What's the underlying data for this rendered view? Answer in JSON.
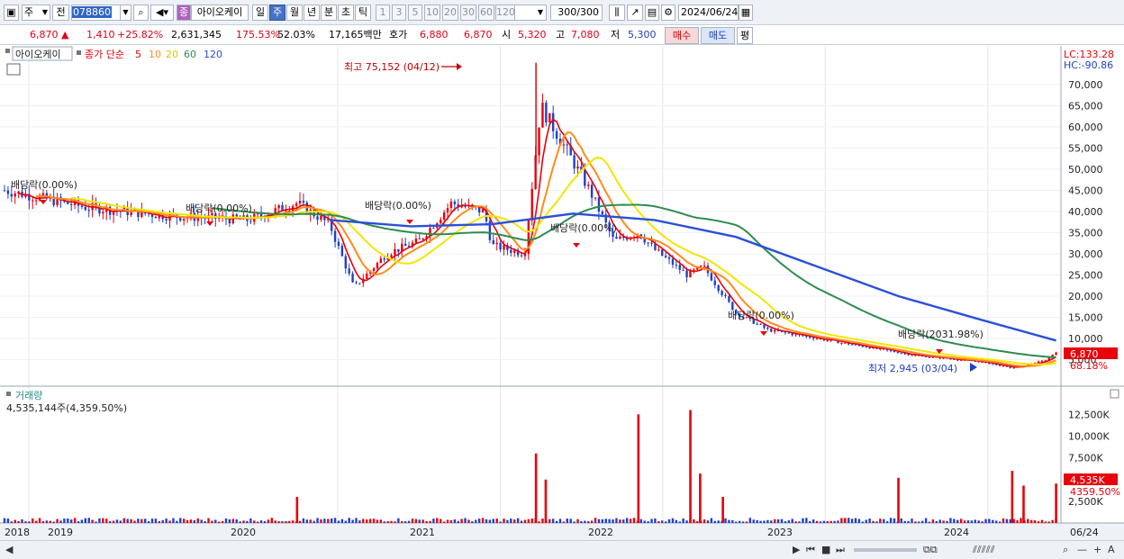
{
  "toolbar": {
    "period_select": "주",
    "prev_label": "전",
    "code_value": "078860",
    "name_badge": "종",
    "stock_name": "아이오케이",
    "tabs": [
      "일",
      "주",
      "월",
      "년",
      "분",
      "초",
      "틱"
    ],
    "selected_tab": "주",
    "interval_buttons": [
      "1",
      "3",
      "5",
      "10",
      "20",
      "30",
      "60",
      "120"
    ],
    "count_value": "300",
    "count_total": "/300",
    "date_value": "2024/06/24"
  },
  "quote": {
    "price": "6,870",
    "change": "1,410",
    "change_pct": "+25.82%",
    "volume": "2,631,345",
    "vol_ratio": "175.53%",
    "turnover": "52.03%",
    "amount": "17,165백만",
    "ask_label": "호가",
    "ask_value": "6,880",
    "bid_value": "6,870",
    "open_label": "시",
    "open_value": "5,320",
    "high_label": "고",
    "high_value": "7,080",
    "low_label": "저",
    "low_value": "5,300",
    "buy_button": "매수",
    "sell_button": "매도",
    "eval_button": "평"
  },
  "price_panel": {
    "legend_name": "아이오케이",
    "legend_ma_label": "종가 단순",
    "ma_periods": [
      "5",
      "10",
      "20",
      "60",
      "120"
    ],
    "ma_colors": [
      "#e8000b",
      "#ff8c1a",
      "#f2e600",
      "#2d8c4e",
      "#2a50d8"
    ],
    "lc_label": "LC:133.28",
    "hc_label": "HC:-90.86",
    "current_price_tag": "6,870",
    "current_pct_tag": "68.18%",
    "high_annotation": "최고 75,152 (04/12)",
    "low_annotation": "최저 2,945 (03/04)",
    "dividend_labels": [
      "배당락(0.00%)",
      "배당락(0.00%)",
      "배당락(0.00%)",
      "배당락(0.00%)",
      "배당락(0.00%)",
      "배당락(2031.98%)"
    ],
    "y_ticks": [
      "70,000",
      "65,000",
      "60,000",
      "55,000",
      "50,000",
      "45,000",
      "40,000",
      "35,000",
      "30,000",
      "25,000",
      "20,000",
      "15,000",
      "10,000",
      "5,000"
    ]
  },
  "volume_panel": {
    "title": "거래량",
    "value_line": "4,535,144주(4,359.50%)",
    "current_tag": "4,535K",
    "current_pct_tag": "4359.50%",
    "y_ticks": [
      "12,500K",
      "10,000K",
      "7,500K",
      "5,000K",
      "2,500K"
    ]
  },
  "x_axis": {
    "labels": [
      "2018",
      "2019",
      "2020",
      "2021",
      "2022",
      "2023",
      "2024",
      "06/24"
    ]
  },
  "chart_data": {
    "type": "candlestick",
    "title": "",
    "period": "weekly",
    "y_range": [
      0,
      77000
    ],
    "highest": {
      "value": 75152,
      "date": "04/12"
    },
    "lowest": {
      "value": 2945,
      "date": "03/04"
    },
    "close_series": [
      {
        "t": 0.0,
        "v": 45000
      },
      {
        "t": 0.5,
        "v": 41000
      },
      {
        "t": 1.0,
        "v": 39000
      },
      {
        "t": 1.5,
        "v": 38000
      },
      {
        "t": 1.8,
        "v": 42000
      },
      {
        "t": 2.0,
        "v": 37000
      },
      {
        "t": 2.15,
        "v": 22000
      },
      {
        "t": 2.35,
        "v": 30000
      },
      {
        "t": 2.55,
        "v": 33000
      },
      {
        "t": 2.75,
        "v": 42000
      },
      {
        "t": 2.95,
        "v": 40000
      },
      {
        "t": 3.0,
        "v": 32000
      },
      {
        "t": 3.2,
        "v": 30000
      },
      {
        "t": 3.3,
        "v": 65000
      },
      {
        "t": 3.45,
        "v": 55000
      },
      {
        "t": 3.6,
        "v": 45000
      },
      {
        "t": 3.75,
        "v": 33000
      },
      {
        "t": 3.9,
        "v": 35000
      },
      {
        "t": 4.0,
        "v": 31000
      },
      {
        "t": 4.2,
        "v": 25000
      },
      {
        "t": 4.3,
        "v": 27000
      },
      {
        "t": 4.5,
        "v": 16000
      },
      {
        "t": 4.7,
        "v": 12000
      },
      {
        "t": 5.0,
        "v": 10000
      },
      {
        "t": 5.3,
        "v": 8000
      },
      {
        "t": 5.6,
        "v": 6000
      },
      {
        "t": 6.0,
        "v": 4500
      },
      {
        "t": 6.2,
        "v": 3000
      },
      {
        "t": 6.4,
        "v": 4800
      },
      {
        "t": 6.47,
        "v": 6870
      }
    ],
    "ma120_series": [
      {
        "t": 2.0,
        "v": 38000
      },
      {
        "t": 2.5,
        "v": 36500
      },
      {
        "t": 3.0,
        "v": 37000
      },
      {
        "t": 3.5,
        "v": 39500
      },
      {
        "t": 4.0,
        "v": 38000
      },
      {
        "t": 4.5,
        "v": 34000
      },
      {
        "t": 5.0,
        "v": 27000
      },
      {
        "t": 5.5,
        "v": 20000
      },
      {
        "t": 6.0,
        "v": 14500
      },
      {
        "t": 6.47,
        "v": 9500
      }
    ],
    "volume_spikes": [
      {
        "t": 1.8,
        "v": 3000
      },
      {
        "t": 3.27,
        "v": 8000
      },
      {
        "t": 3.33,
        "v": 5000
      },
      {
        "t": 3.9,
        "v": 12500
      },
      {
        "t": 4.22,
        "v": 13000
      },
      {
        "t": 4.28,
        "v": 5700
      },
      {
        "t": 4.42,
        "v": 3000
      },
      {
        "t": 5.5,
        "v": 5200
      },
      {
        "t": 6.2,
        "v": 6000
      },
      {
        "t": 6.27,
        "v": 4300
      },
      {
        "t": 6.47,
        "v": 4535
      }
    ]
  }
}
